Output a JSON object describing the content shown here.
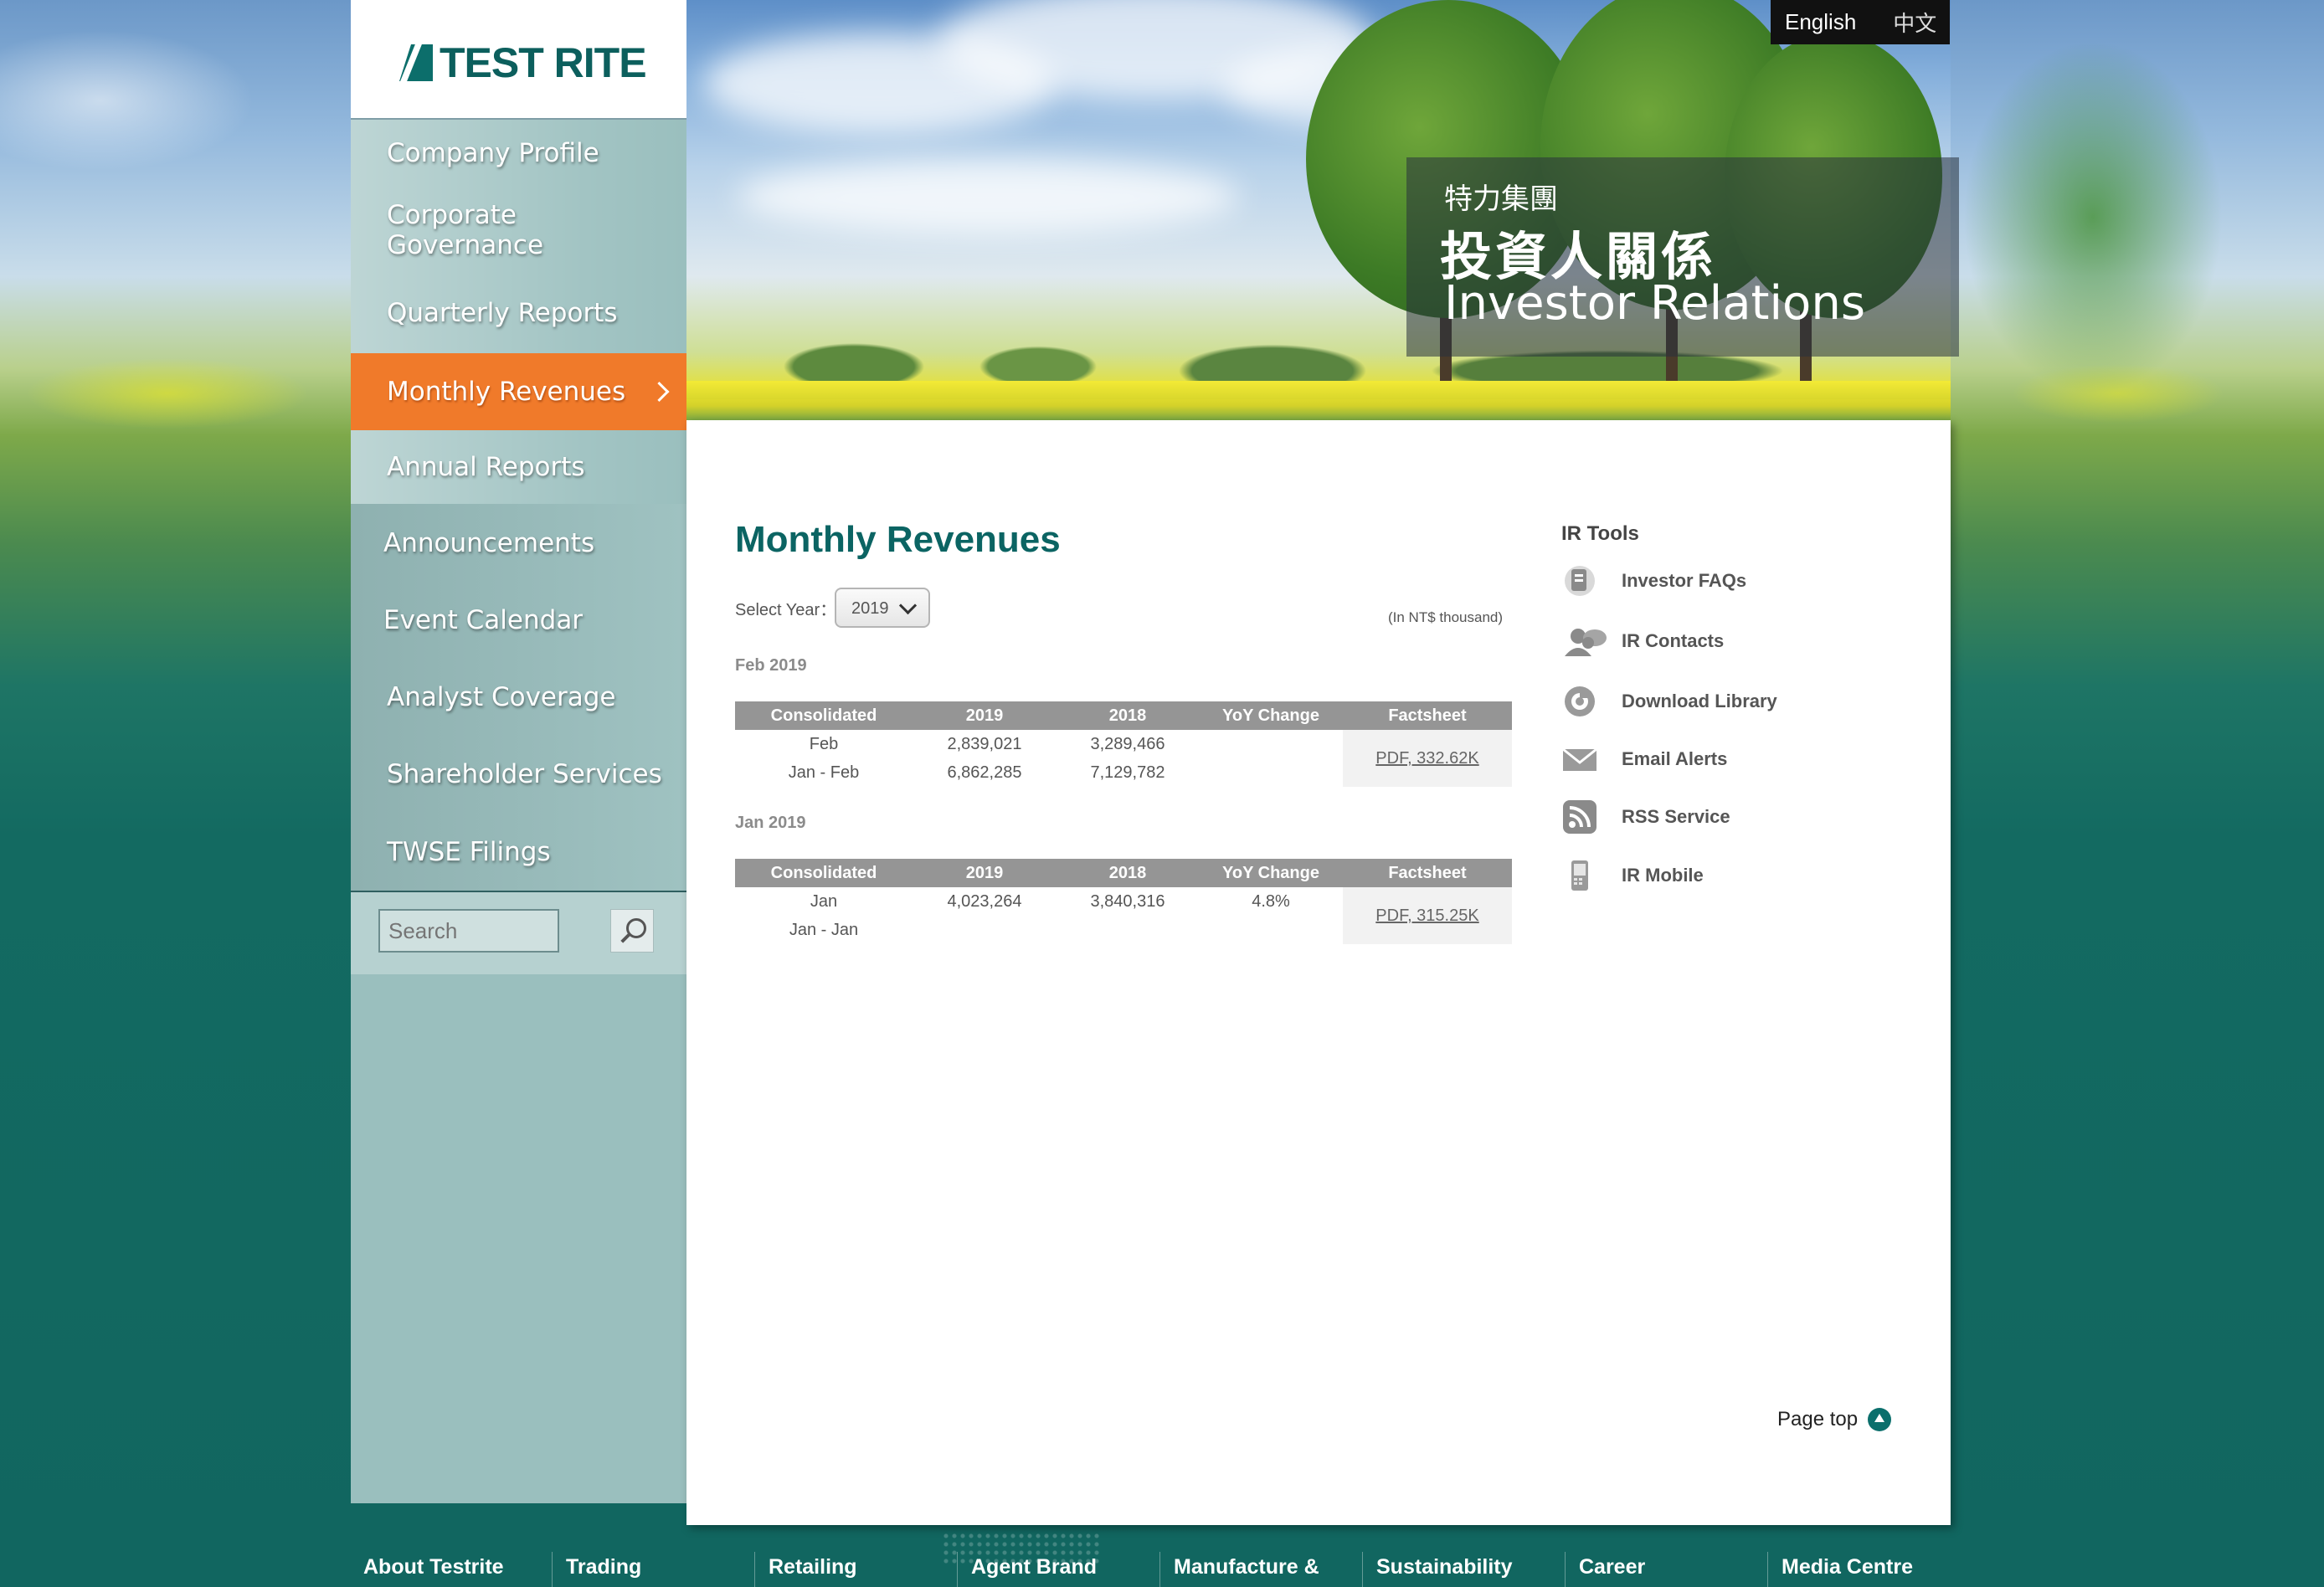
{
  "brand": {
    "logo_text": "TEST RITE"
  },
  "language": {
    "english": "English",
    "chinese": "中文"
  },
  "banner": {
    "group_name": "特力集團",
    "title_zh": "投資人關係",
    "title_en": "Investor Relations"
  },
  "nav": {
    "items": [
      {
        "label": "Company Profile"
      },
      {
        "label": "Corporate Governance"
      },
      {
        "label": "Quarterly Reports"
      },
      {
        "label": "Monthly Revenues"
      },
      {
        "label": "Annual Reports"
      },
      {
        "label": "Announcements"
      },
      {
        "label": "Event Calendar"
      },
      {
        "label": "Analyst Coverage"
      },
      {
        "label": "Shareholder Services"
      },
      {
        "label": "TWSE Filings"
      }
    ],
    "active_index": 3
  },
  "search": {
    "placeholder": "Search"
  },
  "main": {
    "title": "Monthly Revenues",
    "select_year_label": "Select Year：",
    "selected_year": "2019",
    "unit_note": "(In NT$ thousand)",
    "columns": [
      "Consolidated",
      "2019",
      "2018",
      "YoY Change",
      "Factsheet"
    ],
    "periods": [
      {
        "title": "Feb 2019",
        "rows": [
          {
            "label": "Feb",
            "y2019": "2,839,021",
            "y2018": "3,289,466",
            "yoy": ""
          },
          {
            "label": "Jan - Feb",
            "y2019": "6,862,285",
            "y2018": "7,129,782",
            "yoy": ""
          }
        ],
        "factsheet": "PDF, 332.62K"
      },
      {
        "title": "Jan 2019",
        "rows": [
          {
            "label": "Jan",
            "y2019": "4,023,264",
            "y2018": "3,840,316",
            "yoy": "4.8%"
          },
          {
            "label": "Jan - Jan",
            "y2019": "",
            "y2018": "",
            "yoy": ""
          }
        ],
        "factsheet": "PDF, 315.25K"
      }
    ]
  },
  "ir_tools": {
    "title": "IR Tools",
    "items": [
      {
        "label": "Investor FAQs",
        "icon": "document-icon"
      },
      {
        "label": "IR Contacts",
        "icon": "contacts-icon"
      },
      {
        "label": "Download Library",
        "icon": "download-icon"
      },
      {
        "label": "Email Alerts",
        "icon": "envelope-icon"
      },
      {
        "label": "RSS Service",
        "icon": "rss-icon"
      },
      {
        "label": "IR Mobile",
        "icon": "mobile-icon"
      }
    ]
  },
  "page_top": "Page top",
  "footer": {
    "items": [
      "About Testrite",
      "Trading",
      "Retailing",
      "Agent Brand",
      "Manufacture &",
      "Sustainability",
      "Career",
      "Media Centre"
    ]
  },
  "colors": {
    "accent": "#f07a2a",
    "brand": "#0b6463",
    "sidebar": "#9abfbe",
    "table_header": "#959595"
  }
}
